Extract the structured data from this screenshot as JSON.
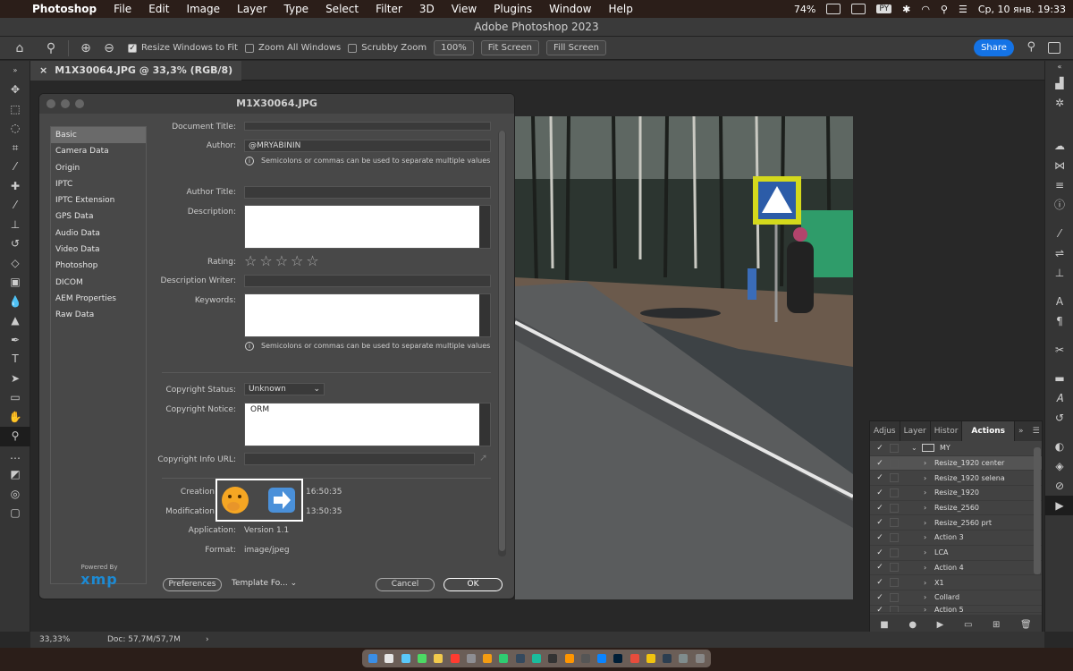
{
  "menubar": {
    "app": "Photoshop",
    "items": [
      "File",
      "Edit",
      "Image",
      "Layer",
      "Type",
      "Select",
      "Filter",
      "3D",
      "View",
      "Plugins",
      "Window",
      "Help"
    ],
    "battery": "74%",
    "input_source": "PY",
    "clock": "Ср, 10 янв. 19:33"
  },
  "window_title": "Adobe Photoshop 2023",
  "options": {
    "resize_windows": "Resize Windows to Fit",
    "zoom_all": "Zoom All Windows",
    "scrubby": "Scrubby Zoom",
    "zoom_value": "100%",
    "fit_screen": "Fit Screen",
    "fill_screen": "Fill Screen",
    "share": "Share"
  },
  "document_tab": "M1X30064.JPG @ 33,3% (RGB/8)",
  "status": {
    "zoom": "33,33%",
    "doc": "Doc: 57,7M/57,7M"
  },
  "dialog": {
    "title": "M1X30064.JPG",
    "categories": [
      "Basic",
      "Camera Data",
      "Origin",
      "IPTC",
      "IPTC Extension",
      "GPS Data",
      "Audio Data",
      "Video Data",
      "Photoshop",
      "DICOM",
      "AEM Properties",
      "Raw Data"
    ],
    "powered_by": "Powered By",
    "xmp": "xmp",
    "labels": {
      "doc_title": "Document Title:",
      "author": "Author:",
      "author_title": "Author Title:",
      "description": "Description:",
      "rating": "Rating:",
      "desc_writer": "Description Writer:",
      "keywords": "Keywords:",
      "copyright_status": "Copyright Status:",
      "copyright_notice": "Copyright Notice:",
      "copyright_url": "Copyright Info URL:",
      "creation": "Creation",
      "modification": "Modification",
      "application": "Application:",
      "format": "Format:"
    },
    "values": {
      "author": "@MRYABININ",
      "hint": "Semicolons or commas can be used to separate multiple values",
      "copyright_status": "Unknown",
      "copyright_notice": "ORM",
      "creation_time": "16:50:35",
      "modification_time": "13:50:35",
      "application": "Version 1.1",
      "format": "image/jpeg"
    },
    "buttons": {
      "preferences": "Preferences",
      "template": "Template Fo...",
      "cancel": "Cancel",
      "ok": "OK"
    }
  },
  "actions_panel": {
    "tabs": [
      "Adjus",
      "Layer",
      "Histor",
      "Actions"
    ],
    "folder": "MY",
    "items": [
      "Resize_1920 center",
      "Resize_1920 selena",
      "Resize_1920",
      "Resize_2560",
      "Resize_2560 prt",
      "Action 3",
      "LCA",
      "Action 4",
      "X1",
      "Collard",
      "Action 5"
    ],
    "highlighted": 0
  }
}
